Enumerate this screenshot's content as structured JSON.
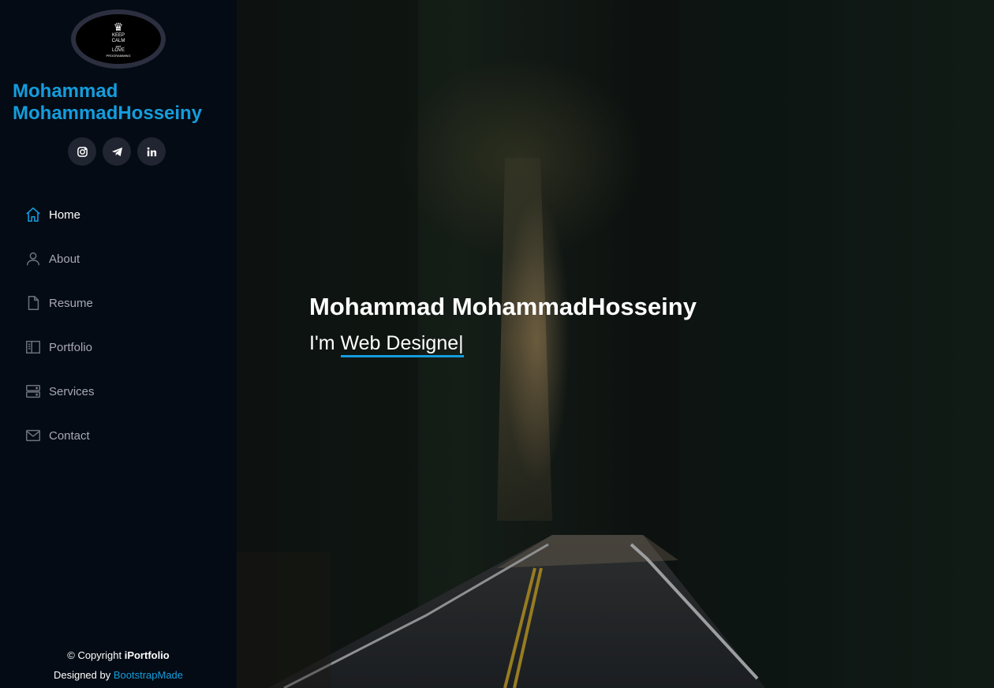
{
  "profile": {
    "avatar_lines": [
      "KEEP",
      "CALM",
      "and",
      "LOVE",
      "PROGRAMMING"
    ],
    "name": "Mohammad MohammadHosseiny"
  },
  "socials": [
    {
      "icon": "instagram-icon"
    },
    {
      "icon": "telegram-icon"
    },
    {
      "icon": "linkedin-icon"
    }
  ],
  "nav": {
    "items": [
      {
        "label": "Home",
        "icon": "house-icon",
        "active": true
      },
      {
        "label": "About",
        "icon": "person-icon",
        "active": false
      },
      {
        "label": "Resume",
        "icon": "file-icon",
        "active": false
      },
      {
        "label": "Portfolio",
        "icon": "book-half-icon",
        "active": false
      },
      {
        "label": "Services",
        "icon": "server-icon",
        "active": false
      },
      {
        "label": "Contact",
        "icon": "envelope-icon",
        "active": false
      }
    ]
  },
  "hero": {
    "title": "Mohammad MohammadHosseiny",
    "prefix": "I'm",
    "typed": "Web Designe",
    "caret": "|"
  },
  "footer": {
    "copyright_prefix": "© Copyright",
    "brand": "iPortfolio",
    "designed_by": "Designed by",
    "credit": "BootstrapMade"
  },
  "colors": {
    "accent": "#149ddd",
    "sidebar_bg": "#040b14",
    "nav_text": "#a8a9b4",
    "social_bg": "#212431"
  }
}
